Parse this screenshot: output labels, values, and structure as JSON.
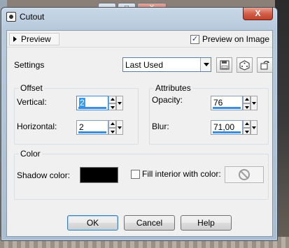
{
  "window": {
    "title": "Cutout",
    "close_label": "X"
  },
  "behind_window": {
    "min_label": "_",
    "max_label": "□",
    "close_label": "X"
  },
  "preview": {
    "tab_label": "Preview",
    "on_image_label": "Preview on Image",
    "on_image_checked": true
  },
  "settings": {
    "label": "Settings",
    "preset_value": "Last Used"
  },
  "offset": {
    "title": "Offset",
    "vertical_label": "Vertical:",
    "vertical_value": "2",
    "horizontal_label": "Horizontal:",
    "horizontal_value": "2"
  },
  "attributes": {
    "title": "Attributes",
    "opacity_label": "Opacity:",
    "opacity_value": "76",
    "blur_label": "Blur:",
    "blur_value": "71,00"
  },
  "color": {
    "title": "Color",
    "shadow_color_label": "Shadow color:",
    "shadow_color": "#000000",
    "fill_interior_label": "Fill interior with color:",
    "fill_interior_checked": false
  },
  "buttons": {
    "ok": "OK",
    "cancel": "Cancel",
    "help": "Help"
  }
}
